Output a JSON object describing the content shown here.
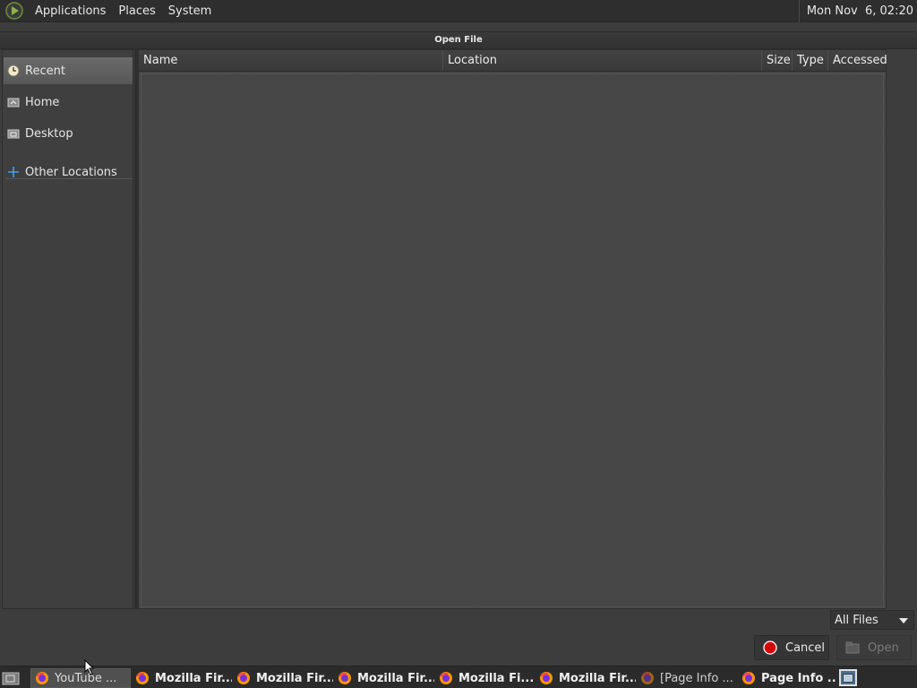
{
  "top_panel": {
    "menus": [
      "Applications",
      "Places",
      "System"
    ],
    "clock": "Mon Nov  6, 02:20"
  },
  "dialog": {
    "title": "Open File",
    "sidebar": {
      "items": [
        {
          "label": "Recent",
          "icon": "clock-icon",
          "selected": true
        },
        {
          "label": "Home",
          "icon": "home-folder-icon",
          "selected": false
        },
        {
          "label": "Desktop",
          "icon": "desktop-folder-icon",
          "selected": false
        },
        {
          "label": "Other Locations",
          "icon": "plus-icon",
          "selected": false
        }
      ]
    },
    "file_list": {
      "columns": [
        "Name",
        "Location",
        "Size",
        "Type",
        "Accessed"
      ],
      "rows": []
    },
    "filter": {
      "selected": "All Files"
    },
    "buttons": {
      "cancel": "Cancel",
      "open": "Open"
    }
  },
  "taskbar": {
    "tasks": [
      {
        "label": "YouTube ...",
        "active": true,
        "bold": false
      },
      {
        "label": "Mozilla Fir...",
        "active": false,
        "bold": true
      },
      {
        "label": "Mozilla Fir...",
        "active": false,
        "bold": true
      },
      {
        "label": "Mozilla Fir...",
        "active": false,
        "bold": true
      },
      {
        "label": "Mozilla Fi...",
        "active": false,
        "bold": true
      },
      {
        "label": "Mozilla Fir...",
        "active": false,
        "bold": true
      },
      {
        "label": "[Page Info ...",
        "active": false,
        "bold": false
      },
      {
        "label": "Page Info ...",
        "active": false,
        "bold": true
      }
    ]
  },
  "colors": {
    "panel": "#2e2e2e",
    "dialog_bg": "#3d3d3d",
    "list_bg": "#474747",
    "selection": "#5f5f5f",
    "cancel_icon": "#d40000"
  }
}
